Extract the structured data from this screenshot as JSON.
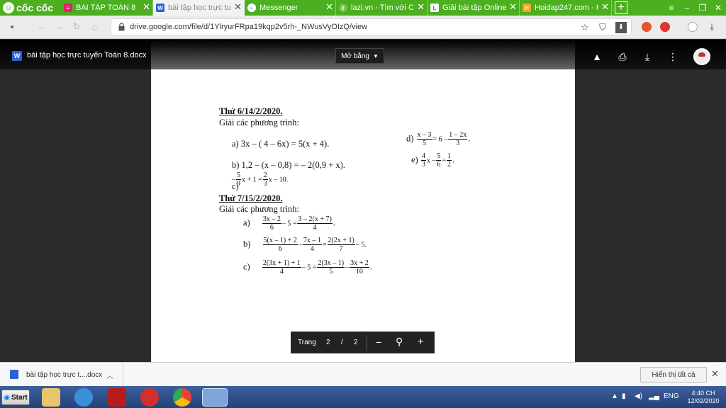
{
  "browser": {
    "brand": "cốc cốc",
    "tabs": [
      {
        "label": "BÀI TẬP TOÁN 8",
        "active": false
      },
      {
        "label": "bài tập học trực tu",
        "active": true
      },
      {
        "label": "Messenger",
        "active": false
      },
      {
        "label": "lazi.vn - Tìm với Cố",
        "active": false
      },
      {
        "label": "Giải bài tập Online",
        "active": false
      },
      {
        "label": "Hoidap247.com - H",
        "active": false
      }
    ],
    "url": "drive.google.com/file/d/1YlryurFRpa19kqp2v5rh-_NWusVyOIzQ/view"
  },
  "viewer": {
    "doc_title": "bài tập học trực tuyến Toán 8.docx",
    "open_with": "Mở bằng",
    "pager": {
      "label": "Trang",
      "current": "2",
      "sep": "/",
      "total": "2"
    }
  },
  "document": {
    "h1": "Thứ 6/14/2/2020.",
    "p1": "Giải các phương trình:",
    "a": "a)  3x – ( 4 – 6x) = 5(x + 4).",
    "b": "b) 1,2 – (x – 0,8) = – 2(0,9 + x).",
    "c_label": "c)",
    "d_label": "d)",
    "e_label": "e)",
    "h2": "Thứ 7/15/2/2020.",
    "p2": "Giải các phương trình:",
    "q_a_label": "a)",
    "q_b_label": "b)",
    "q_c_label": "c)",
    "c_text": [
      "5",
      "9",
      "x + 1 =",
      "2",
      "3",
      "x – 10."
    ],
    "d_text": [
      "x – 3",
      "5",
      "= 6 –",
      "1 – 2x",
      "3",
      "."
    ],
    "e_text": [
      "4",
      "3",
      "x –",
      "5",
      "6",
      "=",
      "1",
      "2",
      "."
    ],
    "qa_text": [
      "3x – 2",
      "6",
      "– 5 =",
      "3 – 2(x + 7)",
      "4",
      "."
    ],
    "qb_text": [
      "5(x – 1) + 2",
      "6",
      "–",
      "7x – 1",
      "4",
      "=",
      "2(2x + 1)",
      "7",
      "– 5."
    ],
    "qc_text": [
      "2(3x + 1) + 1",
      "4",
      "– 5 =",
      "2(3x – 1)",
      "5",
      "–",
      "3x + 2",
      "10",
      "."
    ]
  },
  "downloads": {
    "item": "bài tập học trực t....docx",
    "show_all": "Hiển thị tất cả"
  },
  "taskbar": {
    "start": "Start",
    "lang": "ENG",
    "time": "4:40 CH",
    "date": "12/02/2020"
  }
}
